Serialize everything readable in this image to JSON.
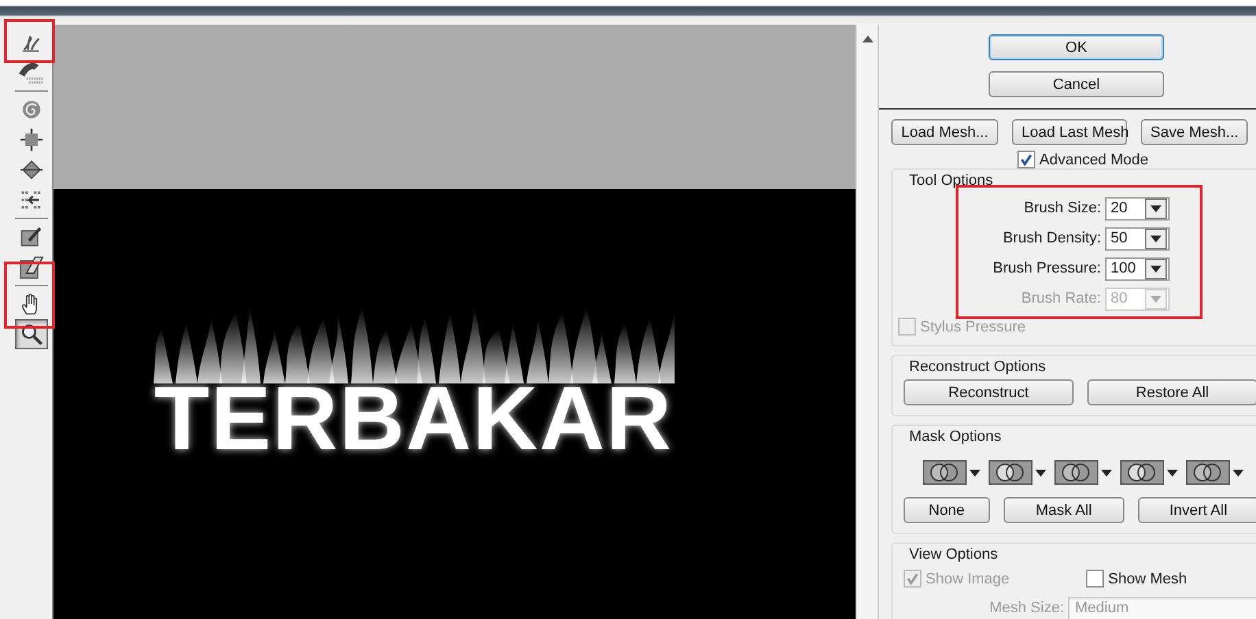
{
  "tools": [
    {
      "kind": "warp",
      "selected": false
    },
    {
      "kind": "reconstruct",
      "selected": false
    },
    {
      "kind": "twirl",
      "selected": false
    },
    {
      "kind": "pucker",
      "selected": false
    },
    {
      "kind": "bloat",
      "selected": false
    },
    {
      "kind": "push",
      "selected": false
    },
    {
      "kind": "freeze",
      "selected": false
    },
    {
      "kind": "thaw",
      "selected": false
    },
    {
      "kind": "hand",
      "selected": false
    },
    {
      "kind": "zoom",
      "selected": true
    }
  ],
  "canvas": {
    "text": "TERBAKAR"
  },
  "dialog_buttons": [
    "OK",
    "Cancel"
  ],
  "mesh_buttons": [
    "Load Mesh...",
    "Load Last Mesh",
    "Save Mesh..."
  ],
  "advanced_mode": {
    "label": "Advanced Mode",
    "checked": true
  },
  "tool_options": {
    "title": "Tool Options",
    "fields": [
      {
        "label": "Brush Size:",
        "value": "20",
        "disabled": false
      },
      {
        "label": "Brush Density:",
        "value": "50",
        "disabled": false
      },
      {
        "label": "Brush Pressure:",
        "value": "100",
        "disabled": false
      },
      {
        "label": "Brush Rate:",
        "value": "80",
        "disabled": true
      }
    ],
    "stylus_pressure": {
      "label": "Stylus Pressure",
      "checked": false,
      "disabled": true
    }
  },
  "reconstruct_options": {
    "title": "Reconstruct Options",
    "buttons": [
      "Reconstruct",
      "Restore All"
    ]
  },
  "mask_options": {
    "title": "Mask Options",
    "buttons": [
      "None",
      "Mask All",
      "Invert All"
    ]
  },
  "view_options": {
    "title": "View Options",
    "show_image": {
      "label": "Show Image",
      "checked": true,
      "disabled": true
    },
    "show_mesh": {
      "label": "Show Mesh",
      "checked": false
    },
    "mesh_size": {
      "label": "Mesh Size:",
      "value": "Medium",
      "disabled": true
    }
  }
}
